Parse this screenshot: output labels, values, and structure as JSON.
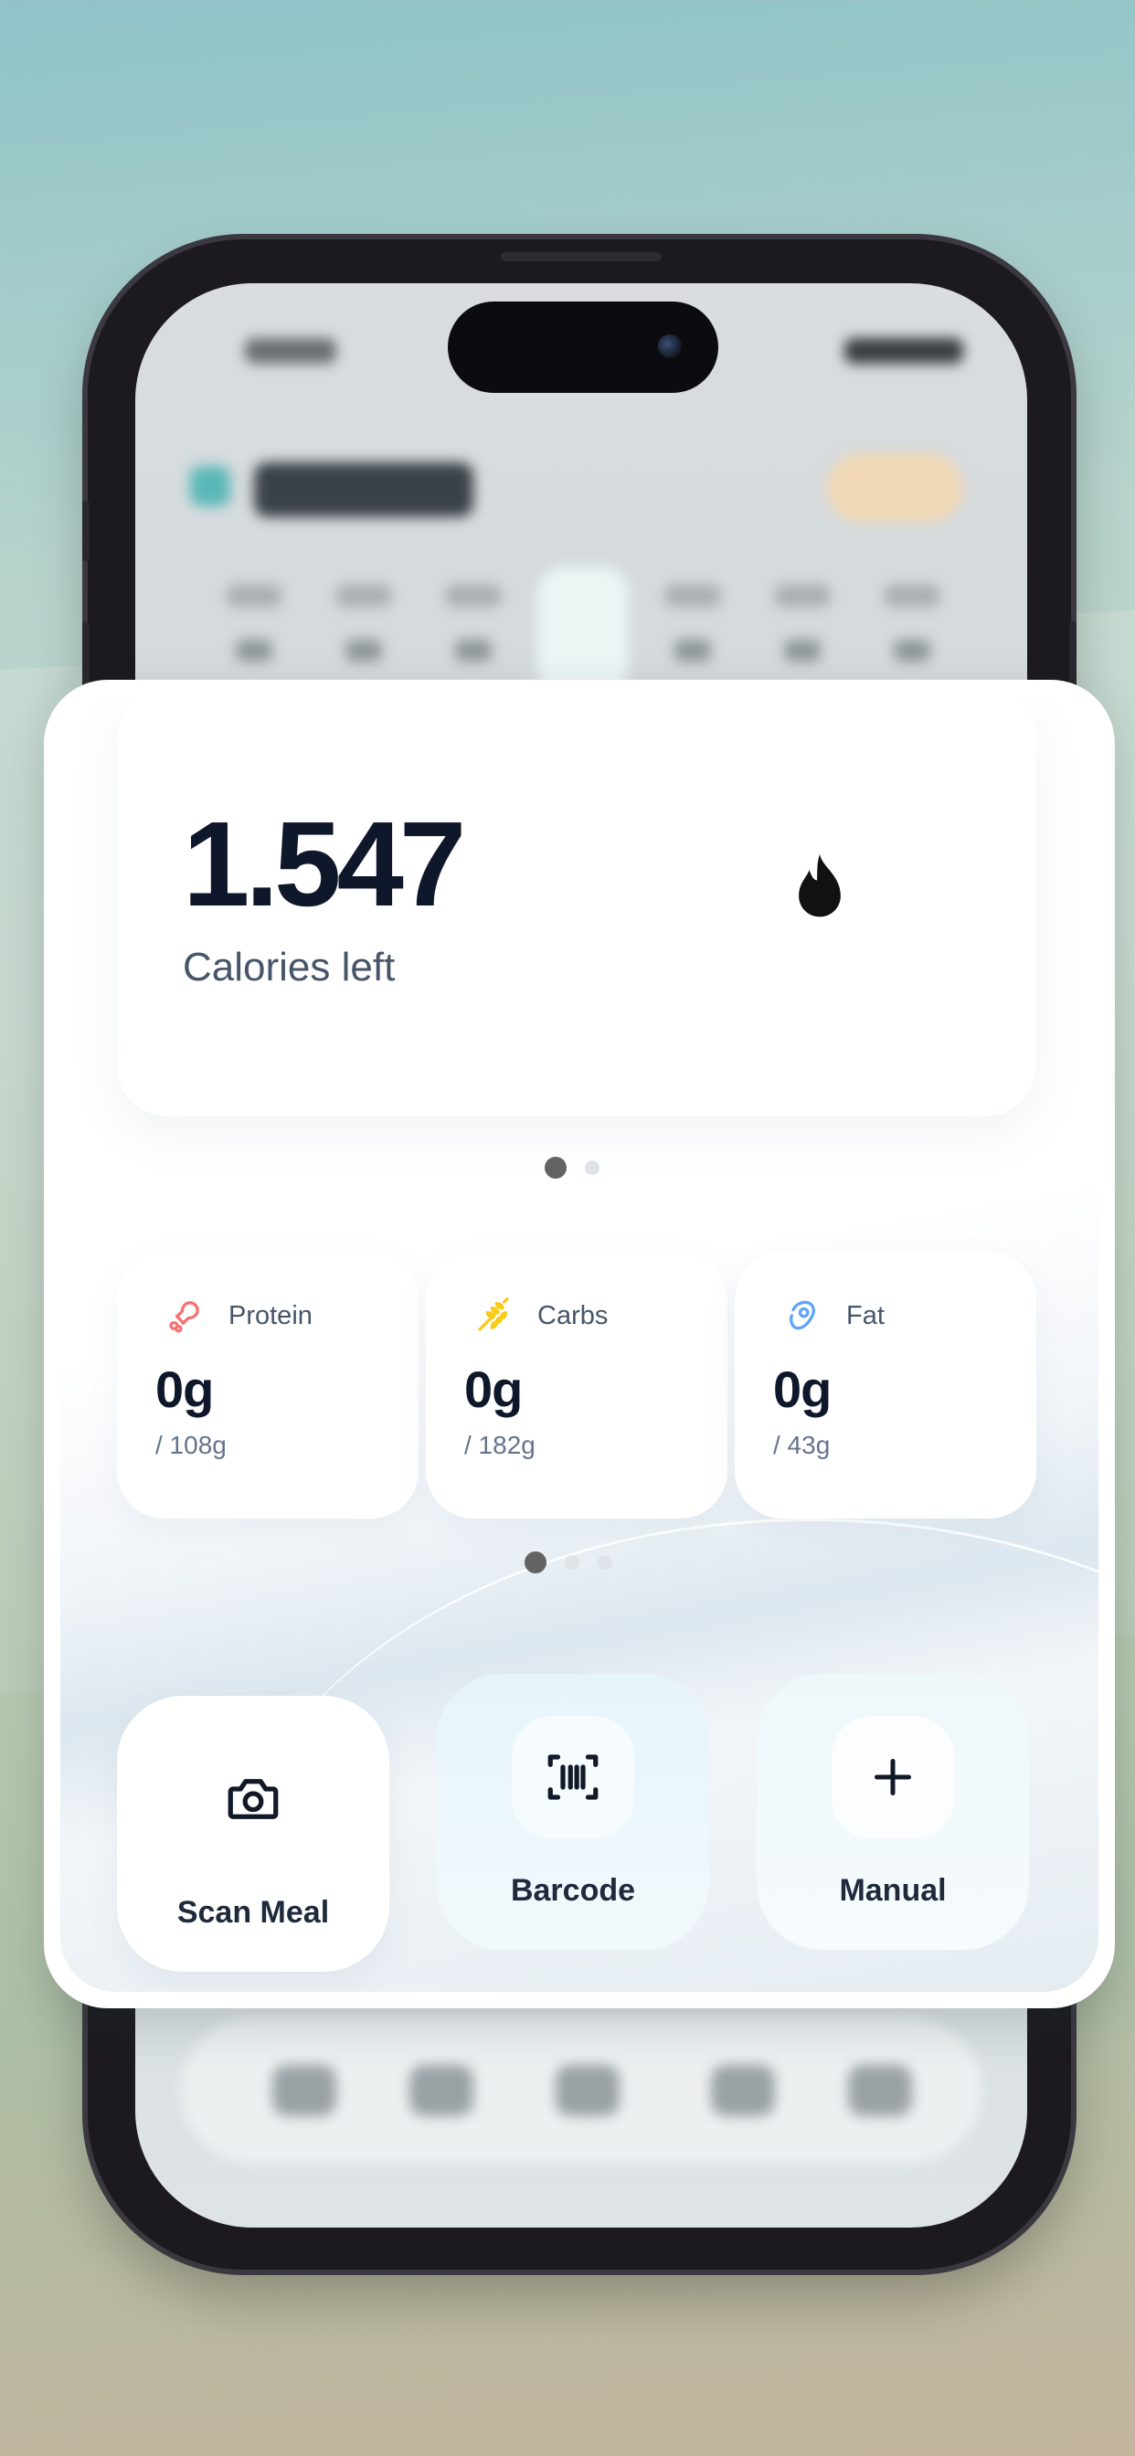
{
  "calories": {
    "value": "1.547",
    "label": "Calories left",
    "icon": "flame-icon"
  },
  "calorie_pager": {
    "pages": 2,
    "active": 1
  },
  "macros": [
    {
      "name": "Protein",
      "value": "0g",
      "goal": "/ 108g",
      "icon": "drumstick-icon",
      "color": "#f87171"
    },
    {
      "name": "Carbs",
      "value": "0g",
      "goal": "/ 182g",
      "icon": "wheat-icon",
      "color": "#facc15"
    },
    {
      "name": "Fat",
      "value": "0g",
      "goal": "/ 43g",
      "icon": "droplet-icon",
      "color": "#60a5fa"
    }
  ],
  "macro_pager": {
    "pages": 3,
    "active": 1
  },
  "actions": [
    {
      "label": "Scan Meal",
      "icon": "camera-icon"
    },
    {
      "label": "Barcode",
      "icon": "barcode-scan-icon"
    },
    {
      "label": "Manual",
      "icon": "plus-icon"
    }
  ],
  "colors": {
    "text_primary": "#0f172a",
    "text_secondary": "#475569",
    "barcode_tint": "#e9f6fb",
    "accent_teal": "#5ab7b7"
  }
}
